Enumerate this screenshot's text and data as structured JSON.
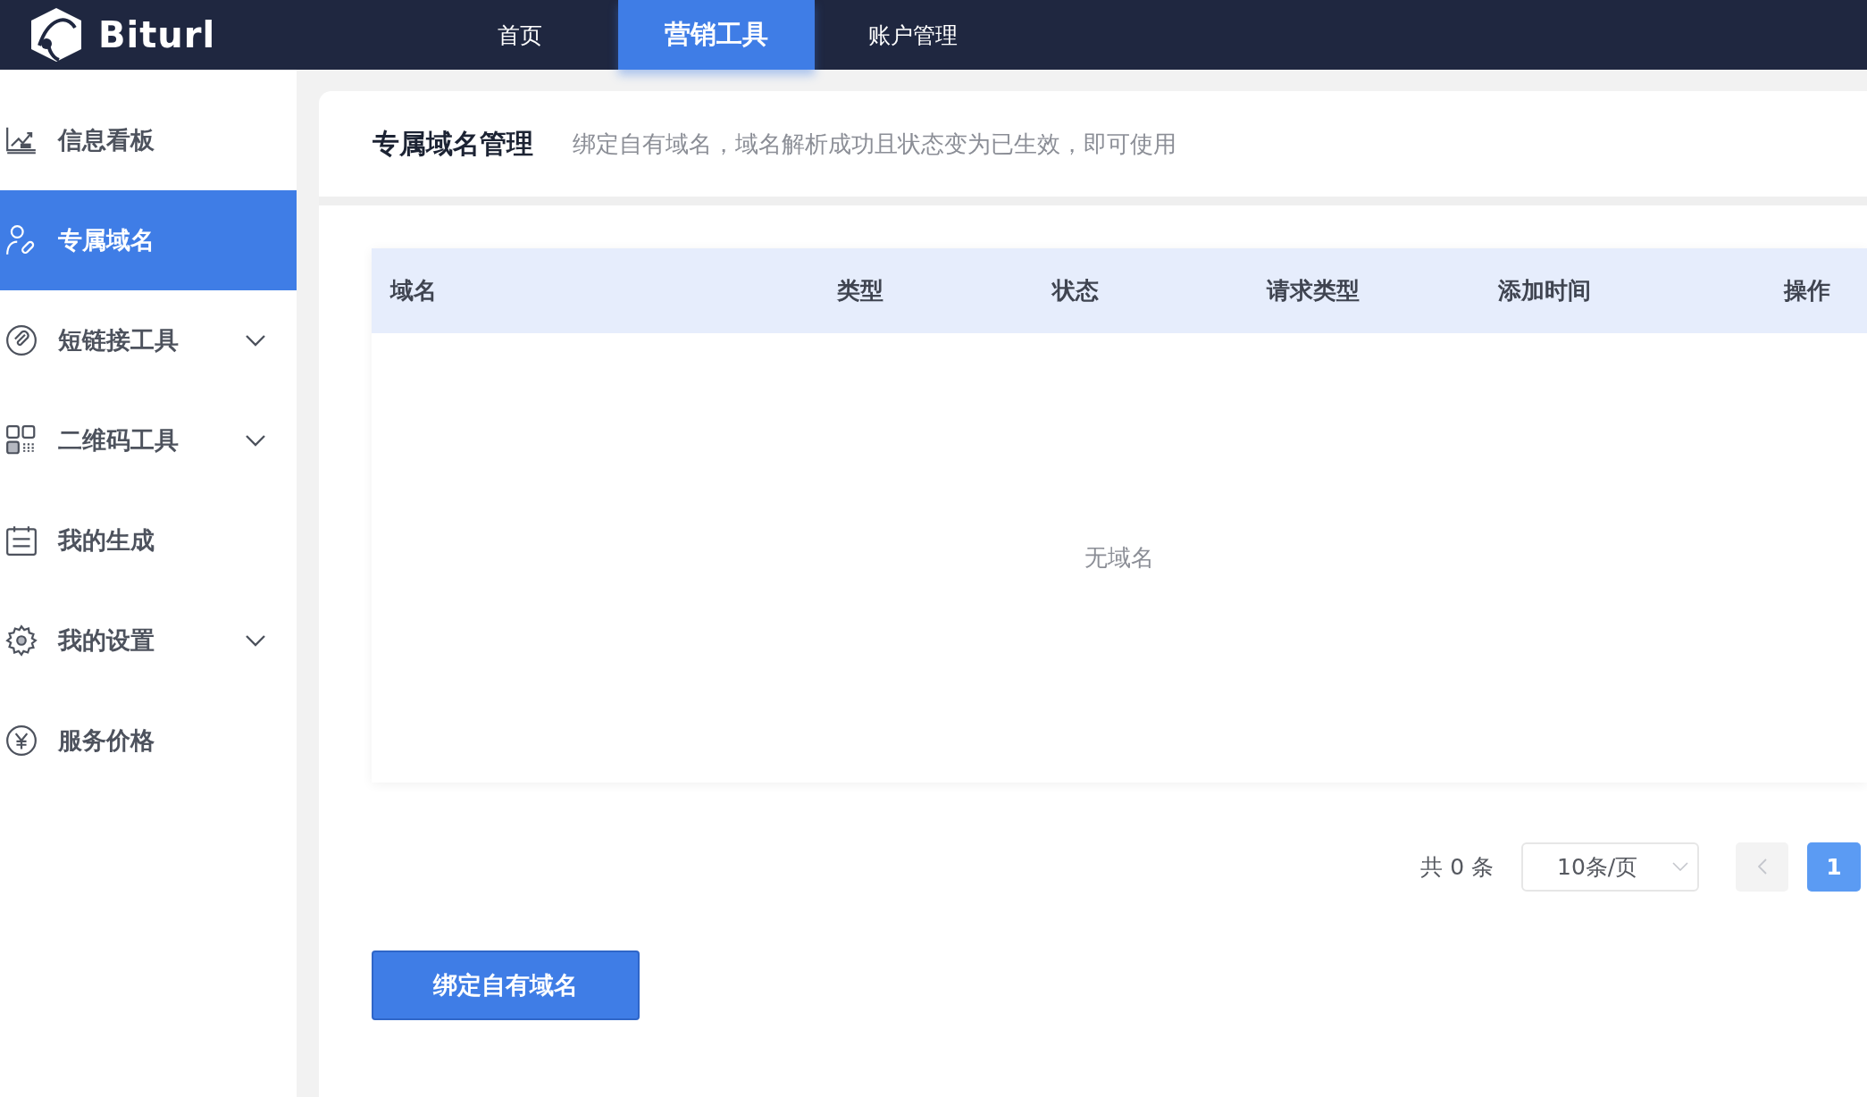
{
  "header": {
    "logo_text": "Biturl",
    "nav": [
      {
        "label": "首页",
        "selected": false
      },
      {
        "label": "营销工具",
        "selected": true
      },
      {
        "label": "账户管理",
        "selected": false
      }
    ]
  },
  "sidebar": {
    "items": [
      {
        "label": "信息看板",
        "kind": "chart",
        "selected": false,
        "expandable": false
      },
      {
        "label": "专属域名",
        "kind": "user-link",
        "selected": true,
        "expandable": false
      },
      {
        "label": "短链接工具",
        "kind": "clip",
        "selected": false,
        "expandable": true
      },
      {
        "label": "二维码工具",
        "kind": "grid",
        "selected": false,
        "expandable": true
      },
      {
        "label": "我的生成",
        "kind": "calendar",
        "selected": false,
        "expandable": false
      },
      {
        "label": "我的设置",
        "kind": "gear",
        "selected": false,
        "expandable": true
      },
      {
        "label": "服务价格",
        "kind": "yen",
        "selected": false,
        "expandable": false
      }
    ]
  },
  "page": {
    "title": "专属域名管理",
    "description": "绑定自有域名，域名解析成功且状态变为已生效，即可使用"
  },
  "table": {
    "columns": [
      "域名",
      "类型",
      "状态",
      "请求类型",
      "添加时间",
      "操作"
    ],
    "empty_text": "无域名"
  },
  "pagination": {
    "total": "共 0 条",
    "page_size": "10条/页",
    "prev_disabled": true,
    "pages": [
      {
        "label": "1",
        "selected": true
      }
    ]
  },
  "bind_button": "绑定自有域名"
}
